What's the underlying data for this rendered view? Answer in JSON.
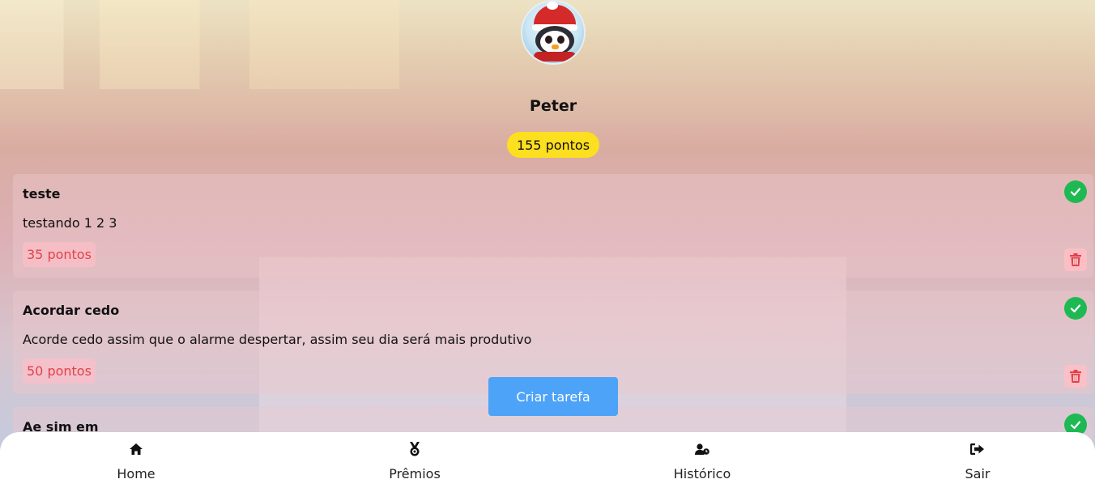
{
  "profile": {
    "name": "Peter",
    "points_label": "155 pontos"
  },
  "tasks": [
    {
      "title": "teste",
      "description": "testando 1 2 3",
      "points_label": "35 pontos"
    },
    {
      "title": "Acordar cedo",
      "description": "Acorde cedo assim que o alarme despertar, assim seu dia será mais produtivo",
      "points_label": "50 pontos"
    },
    {
      "title": "Ae sim em",
      "description": "",
      "points_label": ""
    }
  ],
  "actions": {
    "create_task_label": "Criar tarefa"
  },
  "nav": {
    "items": [
      {
        "label": "Home",
        "icon": "home-icon"
      },
      {
        "label": "Prêmios",
        "icon": "medal-icon"
      },
      {
        "label": "Histórico",
        "icon": "user-clock-icon"
      },
      {
        "label": "Sair",
        "icon": "sign-out-icon"
      }
    ]
  },
  "colors": {
    "points_pill": "#fcdf1f",
    "check": "#1fb954",
    "danger": "#e2424a",
    "primary_button": "#4da3f7"
  }
}
